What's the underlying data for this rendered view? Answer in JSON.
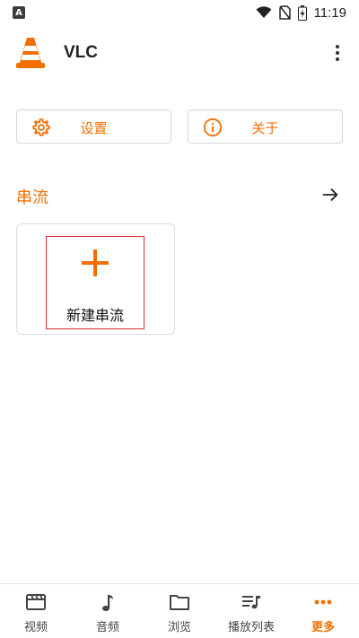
{
  "status_bar": {
    "app_indicator": "A",
    "time": "11:19",
    "icons": [
      "wifi-icon",
      "no-sim-icon",
      "battery-charging-icon"
    ]
  },
  "header": {
    "title": "VLC",
    "logo": "vlc-cone-logo",
    "menu_icon": "overflow-menu-icon"
  },
  "actions": {
    "settings_label": "设置",
    "settings_icon": "gear-icon",
    "about_label": "关于",
    "about_icon": "info-icon"
  },
  "streams": {
    "section_title": "串流",
    "arrow_icon": "arrow-right-icon",
    "new_stream_label": "新建串流",
    "new_stream_icon": "plus-icon"
  },
  "bottom_nav": {
    "items": [
      {
        "label": "视频",
        "icon": "video-icon",
        "active": false
      },
      {
        "label": "音频",
        "icon": "music-note-icon",
        "active": false
      },
      {
        "label": "浏览",
        "icon": "folder-icon",
        "active": false
      },
      {
        "label": "播放列表",
        "icon": "playlist-icon",
        "active": false
      },
      {
        "label": "更多",
        "icon": "more-dots-icon",
        "active": true
      }
    ]
  },
  "colors": {
    "accent": "#f36f00",
    "highlight_box": "#d42a2a",
    "text": "#202020",
    "border": "#d6d6d6"
  }
}
